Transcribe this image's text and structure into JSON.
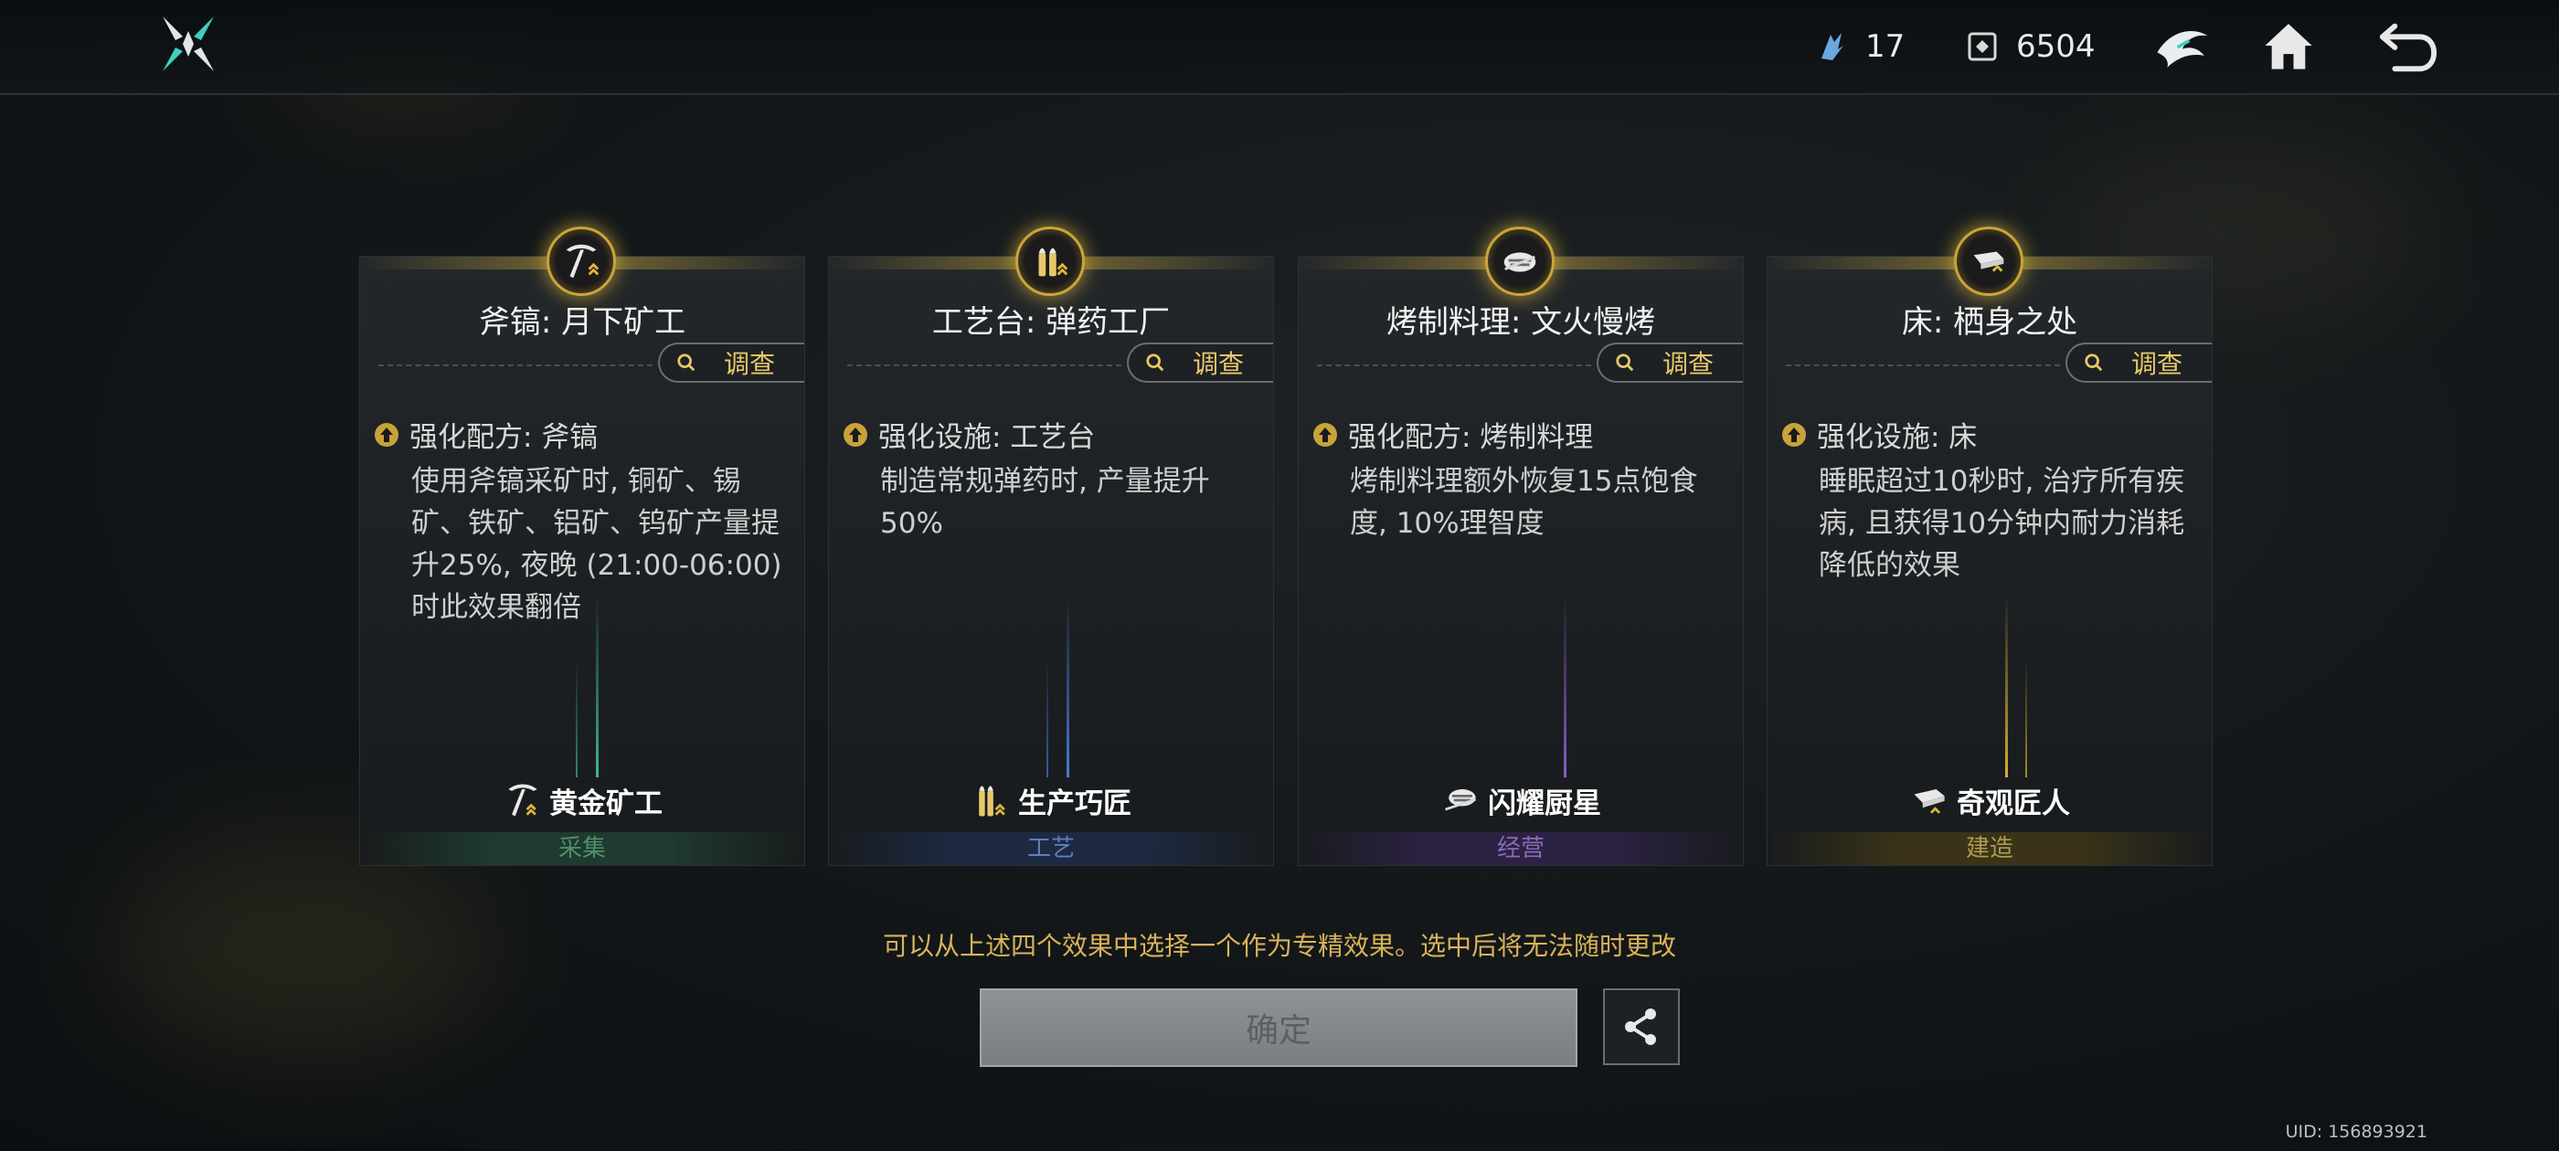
{
  "topbar": {
    "currency_1_value": "17",
    "currency_2_value": "6504"
  },
  "cards": [
    {
      "title": "斧镐: 月下矿工",
      "inspect_label": "调查",
      "effect_title": "强化配方: 斧镐",
      "effect_desc": "使用斧镐采矿时, 铜矿、锡矿、铁矿、铝矿、钨矿产量提升25%, 夜晚 (21:00-06:00) 时此效果翻倍",
      "badge": "黄金矿工",
      "category": "采集",
      "accent": "#3fb88a",
      "category_color": "#4f8f6a",
      "category_bg": "#1f3a2e",
      "icon": "pickaxe-icon"
    },
    {
      "title": "工艺台: 弹药工厂",
      "inspect_label": "调查",
      "effect_title": "强化设施: 工艺台",
      "effect_desc": "制造常规弹药时, 产量提升50%",
      "badge": "生产巧匠",
      "category": "工艺",
      "accent": "#4a7ad8",
      "category_color": "#5e7fb8",
      "category_bg": "#1e2a44",
      "icon": "bullets-icon"
    },
    {
      "title": "烤制料理: 文火慢烤",
      "inspect_label": "调查",
      "effect_title": "强化配方: 烤制料理",
      "effect_desc": "烤制料理额外恢复15点饱食度, 10%理智度",
      "badge": "闪耀厨星",
      "category": "经营",
      "accent": "#8a5ad0",
      "category_color": "#8a6ab8",
      "category_bg": "#2c2244",
      "icon": "grill-icon"
    },
    {
      "title": "床: 栖身之处",
      "inspect_label": "调查",
      "effect_title": "强化设施: 床",
      "effect_desc": "睡眠超过10秒时, 治疗所有疾病, 且获得10分钟内耐力消耗降低的效果",
      "badge": "奇观匠人",
      "category": "建造",
      "accent": "#d8b030",
      "category_color": "#b09a50",
      "category_bg": "#3a3318",
      "icon": "bed-icon"
    }
  ],
  "notice": "可以从上述四个效果中选择一个作为专精效果。选中后将无法随时更改",
  "confirm_label": "确定",
  "uid": "UID: 156893921"
}
